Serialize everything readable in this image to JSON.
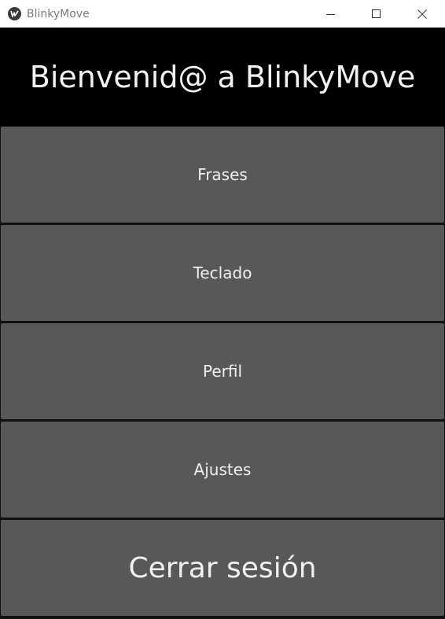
{
  "window": {
    "title": "BlinkyMove",
    "icons": {
      "app": "kivy-logo-icon",
      "minimize": "minimize-icon",
      "maximize": "maximize-icon",
      "close": "close-icon"
    }
  },
  "header": {
    "title": "Bienvenid@ a BlinkyMove"
  },
  "menu": {
    "items": [
      {
        "label": "Frases"
      },
      {
        "label": "Teclado"
      },
      {
        "label": "Perfil"
      },
      {
        "label": "Ajustes"
      },
      {
        "label": "Cerrar sesión"
      }
    ]
  },
  "colors": {
    "header_bg": "#000000",
    "button_bg": "#585858",
    "text": "#f0f0f0"
  }
}
